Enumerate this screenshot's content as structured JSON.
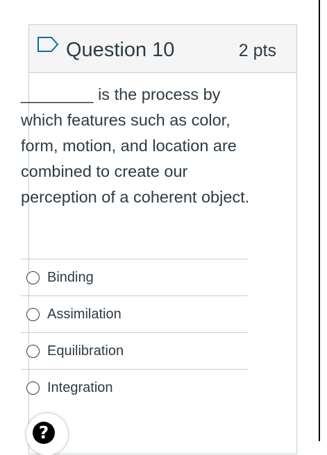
{
  "question": {
    "title": "Question 10",
    "points": "2 pts",
    "flag_icon": "flag-outline-icon",
    "text": "________ is the process by which features such as color, form, motion, and location are combined to create our perception of a coherent object.",
    "answers": [
      {
        "label": "Binding",
        "selected": false
      },
      {
        "label": "Assimilation",
        "selected": false
      },
      {
        "label": "Equilibration",
        "selected": false
      },
      {
        "label": "Integration",
        "selected": false
      }
    ]
  },
  "help": {
    "icon": "question-mark-icon",
    "glyph": "?"
  },
  "colors": {
    "text": "#2d3b45",
    "border": "#c7cdd1",
    "header_bg": "#f5f5f5",
    "flag_stroke": "#0770a3"
  }
}
